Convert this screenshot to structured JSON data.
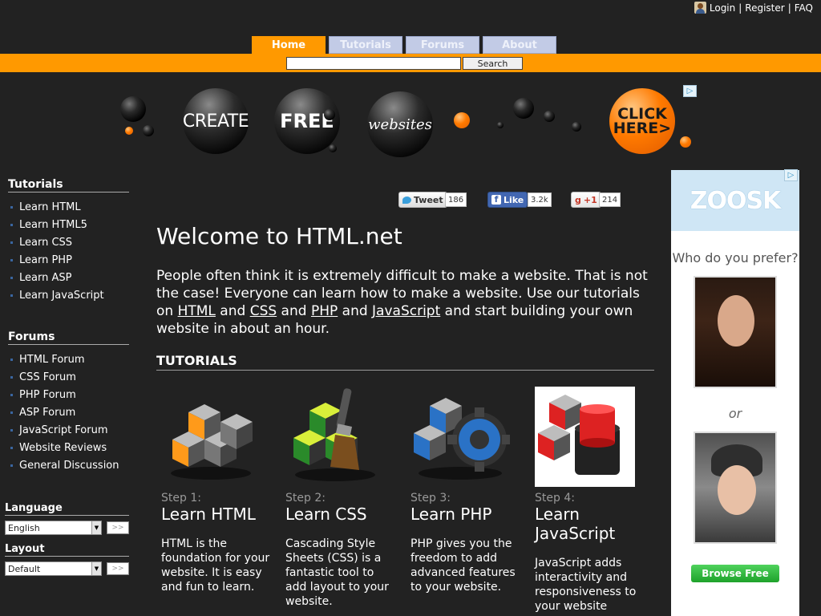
{
  "userbar": {
    "login": "Login",
    "register": "Register",
    "faq": "FAQ",
    "separator": "|"
  },
  "nav": {
    "tabs": [
      {
        "label": "Home",
        "active": true
      },
      {
        "label": "Tutorials",
        "active": false
      },
      {
        "label": "Forums",
        "active": false
      },
      {
        "label": "About",
        "active": false
      }
    ],
    "search_button": "Search",
    "search_value": ""
  },
  "banner": {
    "word1": "CREATE",
    "word2": "FREE",
    "word3": "websites",
    "cta_line1": "CLICK",
    "cta_line2": "HERE>",
    "ad_badge": "▷"
  },
  "sidebar": {
    "tutorials_heading": "Tutorials",
    "tutorials": [
      "Learn HTML",
      "Learn HTML5",
      "Learn CSS",
      "Learn PHP",
      "Learn ASP",
      "Learn JavaScript"
    ],
    "forums_heading": "Forums",
    "forums": [
      "HTML Forum",
      "CSS Forum",
      "PHP Forum",
      "ASP Forum",
      "JavaScript Forum",
      "Website Reviews",
      "General Discussion"
    ],
    "language_heading": "Language",
    "language_value": "English",
    "layout_heading": "Layout",
    "layout_value": "Default",
    "go_label": ">>"
  },
  "share": {
    "tweet_label": "Tweet",
    "tweet_count": "186",
    "like_label": "Like",
    "like_count": "3.2k",
    "gplus_label": "+1",
    "gplus_count": "214"
  },
  "main": {
    "title": "Welcome to HTML.net",
    "intro_1": "People often think it is extremely difficult to make a website. That is not the case! Everyone can learn how to make a website. Use our tutorials on ",
    "link_html": "HTML",
    "and_1": " and ",
    "link_css": "CSS",
    "and_2": " and ",
    "link_php": "PHP",
    "and_3": " and ",
    "link_js": "JavaScript",
    "intro_2": " and start building your own website in about an hour.",
    "tutorials_heading": "TUTORIALS",
    "steps": [
      {
        "label": "Step 1:",
        "title": "Learn HTML",
        "desc": "HTML is the foundation for your website. It is easy and fun to learn."
      },
      {
        "label": "Step 2:",
        "title": "Learn CSS",
        "desc": "Cascading Style Sheets (CSS) is a fantastic tool to add layout to your website."
      },
      {
        "label": "Step 3:",
        "title": "Learn PHP",
        "desc": "PHP gives you the freedom to add advanced features to your website."
      },
      {
        "label": "Step 4:",
        "title": "Learn JavaScript",
        "desc": "JavaScript adds interactivity and responsiveness to your website"
      }
    ]
  },
  "ad": {
    "brand": "ZOOSK",
    "question": "Who do you prefer?",
    "or_text": "or",
    "button": "Browse Free",
    "badge": "▷"
  },
  "colors": {
    "accent": "#ff9900",
    "background": "#222222",
    "tab_inactive": "#c2cbe6"
  }
}
